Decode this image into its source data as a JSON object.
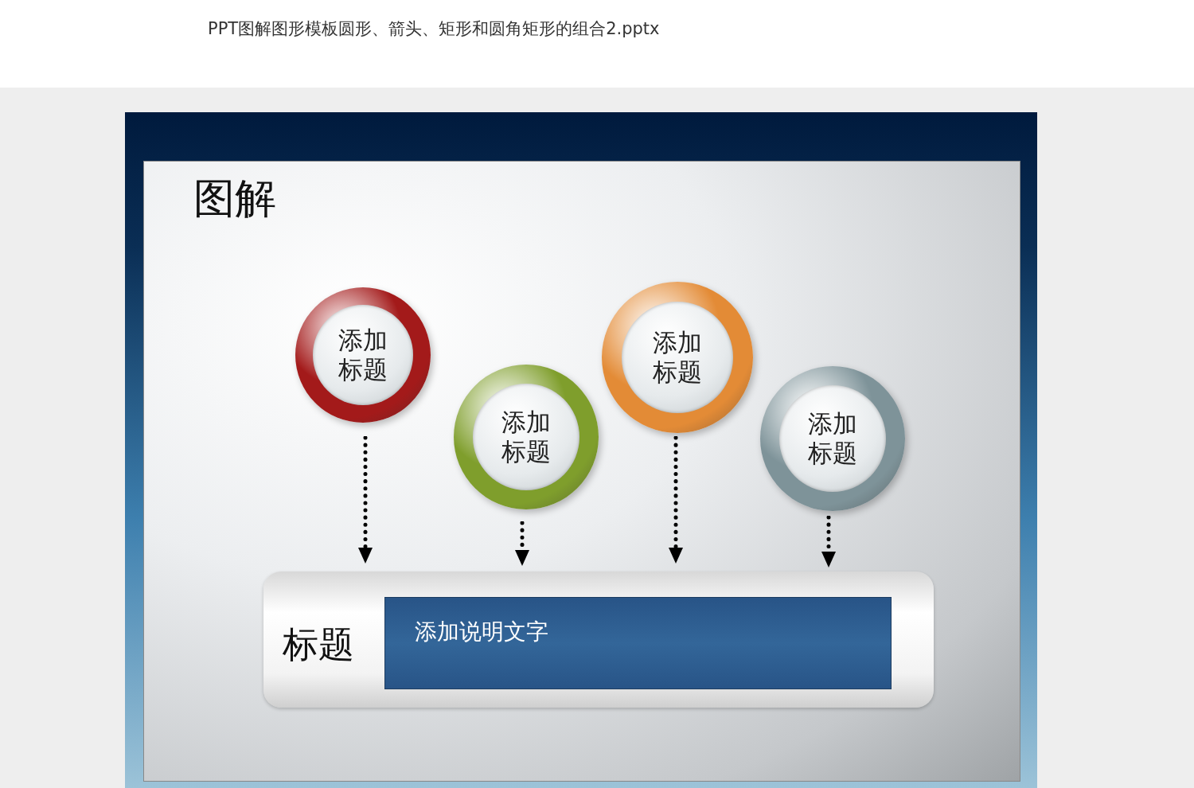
{
  "title": "PPT图解图形模板圆形、箭头、矩形和圆角矩形的组合2.pptx",
  "slide": {
    "heading": "图解",
    "nodes": [
      {
        "label": "添加标题",
        "color": "#a31a1a"
      },
      {
        "label": "添加标题",
        "color": "#7f9e2c"
      },
      {
        "label": "添加标题",
        "color": "#e38b36"
      },
      {
        "label": "添加标题",
        "color": "#7e9399"
      }
    ],
    "bar": {
      "label": "标题",
      "description": "添加说明文字"
    }
  }
}
